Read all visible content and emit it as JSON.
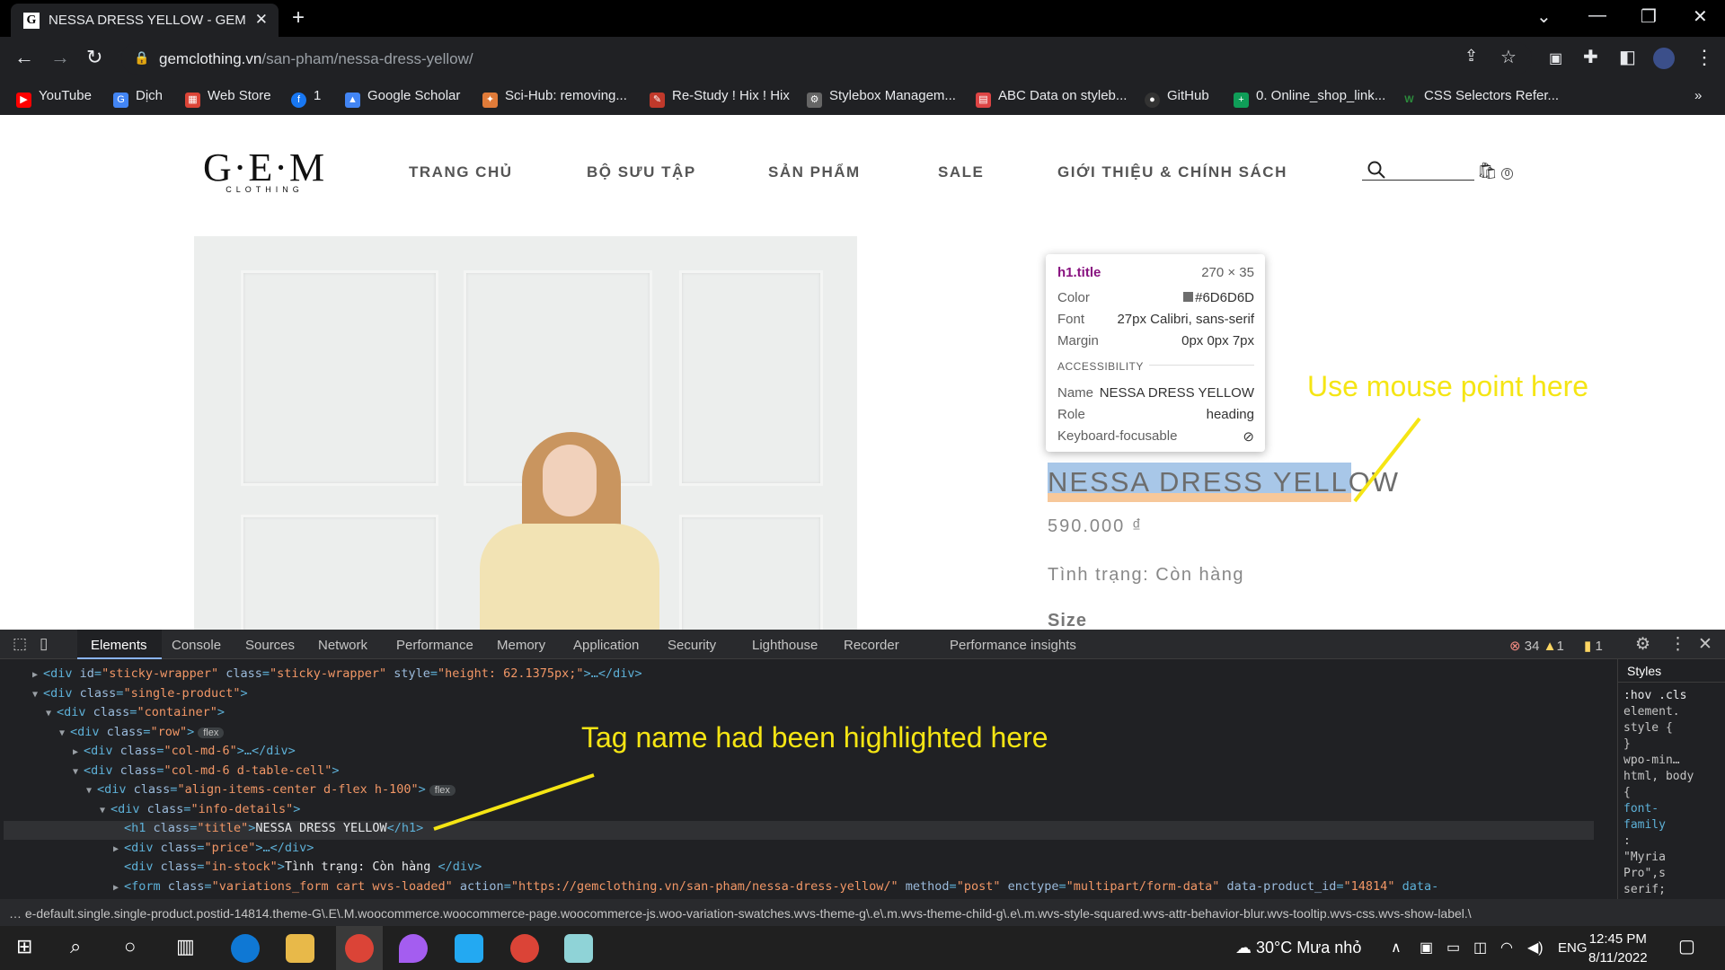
{
  "browser": {
    "tab_title": "NESSA DRESS YELLOW - GEM",
    "url_domain": "gemclothing.vn",
    "url_path": "/san-pham/nessa-dress-yellow/",
    "bookmarks": [
      "YouTube",
      "Dịch",
      "Web Store",
      "1",
      "Google Scholar",
      "Sci-Hub: removing...",
      "Re-Study ! Hix ! Hix",
      "Stylebox Managem...",
      "ABC Data on styleb...",
      "GitHub",
      "0. Online_shop_link...",
      "CSS Selectors Refer..."
    ]
  },
  "site": {
    "logo": "G·E·M",
    "logo_sub": "CLOTHING",
    "menu": [
      "TRANG CHỦ",
      "BỘ SƯU TẬP",
      "SẢN PHẨM",
      "SALE",
      "GIỚI THIỆU & CHÍNH SÁCH"
    ],
    "cart_count": "0",
    "product_title": "NESSA DRESS YELLOW",
    "price": "590.000 ₫",
    "stock": "Tình trạng: Còn hàng",
    "size_label": "Size"
  },
  "inspect_tooltip": {
    "selector": "h1.title",
    "dims": "270 × 35",
    "color_label": "Color",
    "color_value": "#6D6D6D",
    "font_label": "Font",
    "font_value": "27px Calibri, sans-serif",
    "margin_label": "Margin",
    "margin_value": "0px 0px 7px",
    "accessibility_label": "ACCESSIBILITY",
    "name_label": "Name",
    "name_value": "NESSA DRESS YELLOW",
    "role_label": "Role",
    "role_value": "heading",
    "kbd_label": "Keyboard-focusable"
  },
  "annotations": {
    "mouse_note": "Use mouse point here",
    "tag_note": "Tag name had been highlighted here"
  },
  "devtools": {
    "tabs": [
      "Elements",
      "Console",
      "Sources",
      "Network",
      "Performance",
      "Memory",
      "Application",
      "Security",
      "Lighthouse",
      "Recorder",
      "Performance insights"
    ],
    "errors": "34",
    "warnings": "1",
    "issues": "1",
    "dom_lines": [
      {
        "indent": 0,
        "arrow": "▶",
        "open": "div",
        "attrs": [
          [
            "id",
            "sticky-wrapper"
          ],
          [
            "class",
            "sticky-wrapper"
          ],
          [
            "style",
            "height: 62.1375px;"
          ]
        ],
        "tail": ">…</div>"
      },
      {
        "indent": 0,
        "arrow": "▼",
        "open": "div",
        "attrs": [
          [
            "class",
            "single-product"
          ]
        ],
        "tail": ">"
      },
      {
        "indent": 1,
        "arrow": "▼",
        "open": "div",
        "attrs": [
          [
            "class",
            "container"
          ]
        ],
        "tail": ">"
      },
      {
        "indent": 2,
        "arrow": "▼",
        "open": "div",
        "attrs": [
          [
            "class",
            "row"
          ]
        ],
        "tail": ">",
        "badge": "flex"
      },
      {
        "indent": 3,
        "arrow": "▶",
        "open": "div",
        "attrs": [
          [
            "class",
            "col-md-6"
          ]
        ],
        "tail": ">…</div>"
      },
      {
        "indent": 3,
        "arrow": "▼",
        "open": "div",
        "attrs": [
          [
            "class",
            "col-md-6 d-table-cell"
          ]
        ],
        "tail": ">"
      },
      {
        "indent": 4,
        "arrow": "▼",
        "open": "div",
        "attrs": [
          [
            "class",
            "align-items-center d-flex h-100"
          ]
        ],
        "tail": ">",
        "badge": "flex"
      },
      {
        "indent": 5,
        "arrow": "▼",
        "open": "div",
        "attrs": [
          [
            "class",
            "info-details"
          ]
        ],
        "tail": ">"
      },
      {
        "indent": 6,
        "arrow": "",
        "open": "h1",
        "attrs": [
          [
            "class",
            "title"
          ]
        ],
        "tail": ">NESSA DRESS YELLOW</h1>",
        "selected": true
      },
      {
        "indent": 6,
        "arrow": "▶",
        "open": "div",
        "attrs": [
          [
            "class",
            "price"
          ]
        ],
        "tail": ">…</div>"
      },
      {
        "indent": 6,
        "arrow": "",
        "open": "div",
        "attrs": [
          [
            "class",
            "in-stock"
          ]
        ],
        "tail": ">Tình trạng: Còn hàng </div>"
      },
      {
        "indent": 6,
        "arrow": "▶",
        "open": "form",
        "attrs": [
          [
            "class",
            "variations_form cart wvs-loaded"
          ],
          [
            "action",
            "https://gemclothing.vn/san-pham/nessa-dress-yellow/"
          ],
          [
            "method",
            "post"
          ],
          [
            "enctype",
            "multipart/form-data"
          ],
          [
            "data-product_id",
            "14814"
          ]
        ],
        "tail": " data-"
      }
    ],
    "styles_tab": "Styles",
    "styles_lines": [
      ":hov .cls",
      "element.",
      "style {",
      "}",
      "wpo-min…",
      "html, body",
      "{",
      "font-",
      "family",
      ":",
      "\"Myria",
      "Pro\",s",
      "serif;"
    ],
    "breadcrumb": "e-default.single.single-product.postid-14814.theme-G\\.E\\.M.woocommerce.woocommerce-page.woocommerce-js.woo-variation-swatches.wvs-theme-g\\.e\\.m.wvs-theme-child-g\\.e\\.m.wvs-style-squared.wvs-attr-behavior-blur.wvs-tooltip.wvs-css.wvs-show-label.\\"
  },
  "taskbar": {
    "weather": "30°C  Mưa nhỏ",
    "lang": "ENG",
    "time": "12:45 PM",
    "date": "8/11/2022"
  }
}
